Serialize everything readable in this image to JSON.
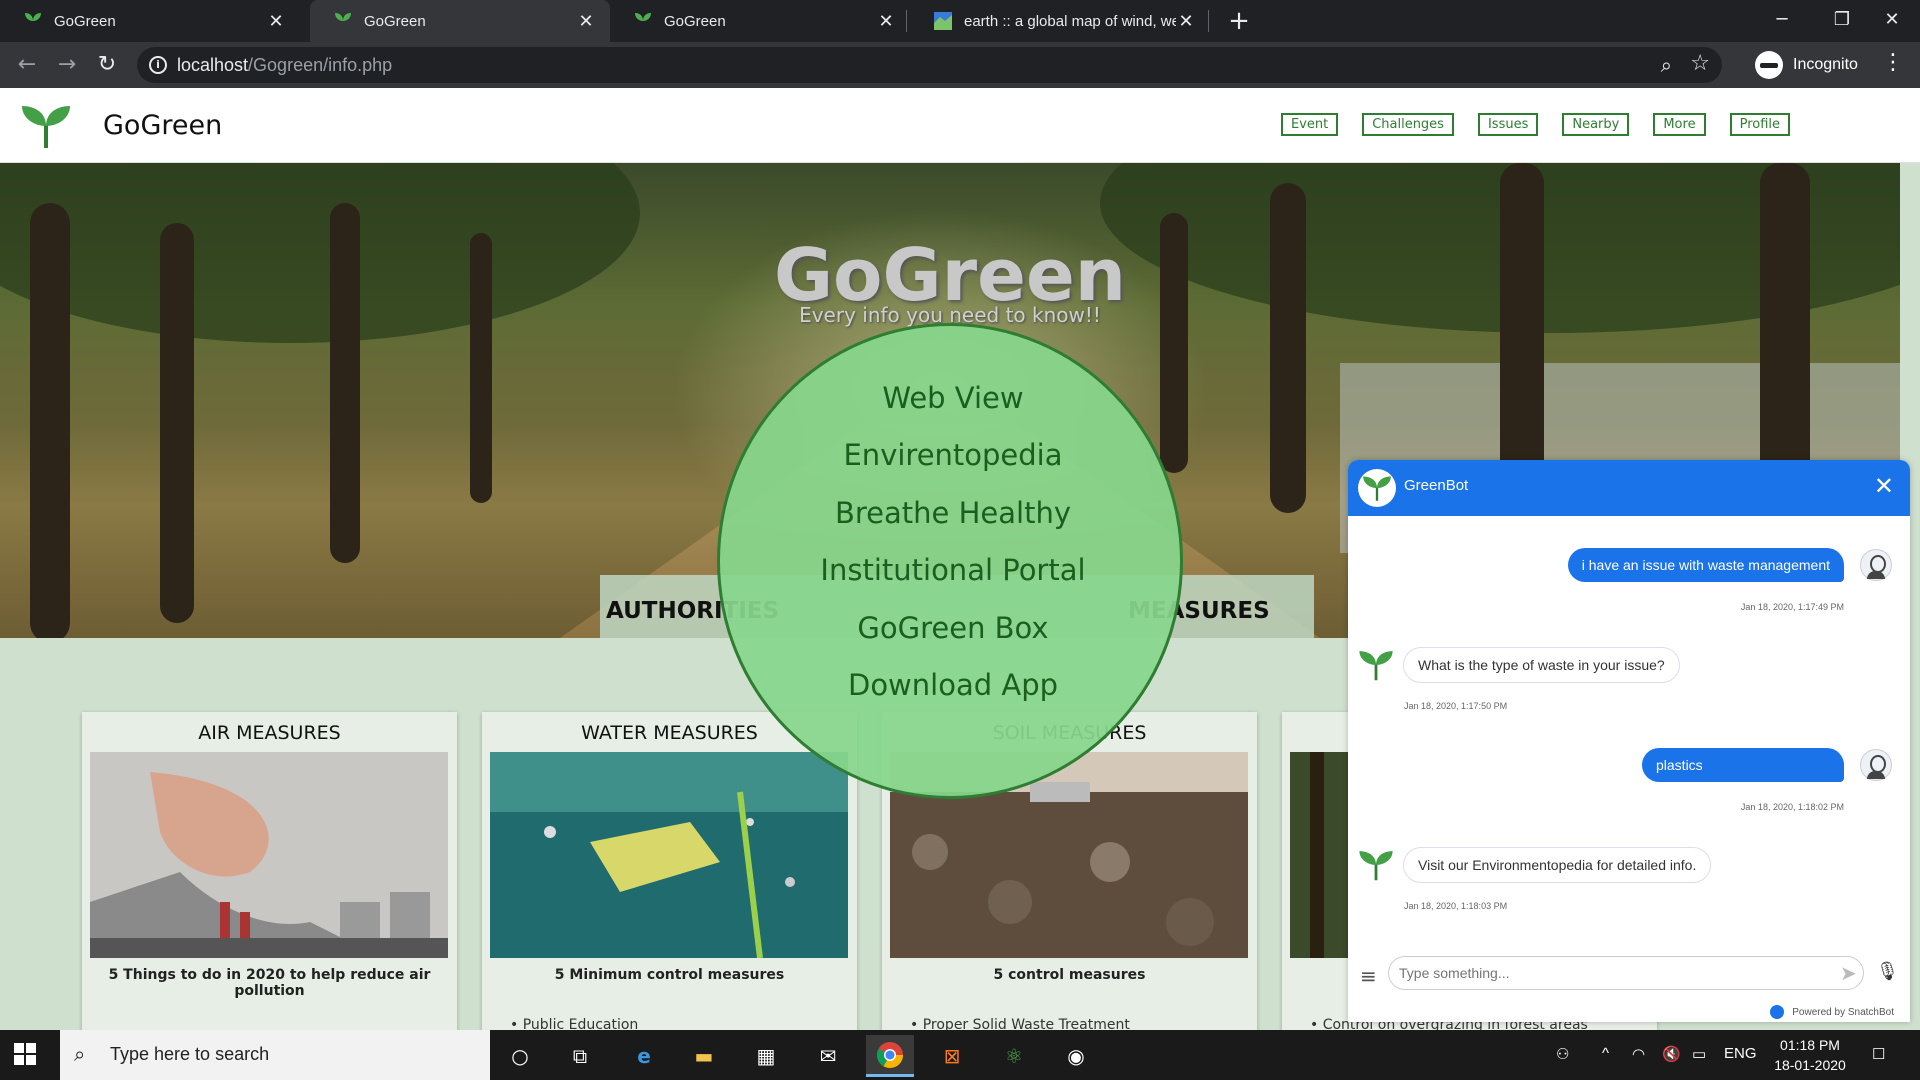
{
  "browser": {
    "tabs": [
      {
        "title": "GoGreen",
        "icon": "leaf-icon"
      },
      {
        "title": "GoGreen",
        "icon": "leaf-icon",
        "active": true
      },
      {
        "title": "GoGreen",
        "icon": "leaf-icon"
      },
      {
        "title": "earth :: a global map of wind, we",
        "icon": "earth-icon"
      }
    ],
    "url_host": "localhost",
    "url_path": "/Gogreen/info.php",
    "profile_label": "Incognito"
  },
  "site": {
    "brand": "GoGreen",
    "nav": [
      "Event",
      "Challenges",
      "Issues",
      "Nearby",
      "More",
      "Profile"
    ]
  },
  "hero": {
    "title": "GoGreen",
    "subtitle": "Every info you need to know!!"
  },
  "section_tabs": {
    "left": "AUTHORITIES",
    "right": "MEASURES"
  },
  "circle_menu": [
    "Web View",
    "Envirentopedia",
    "Breathe Healthy",
    "Institutional Portal",
    "GoGreen Box",
    "Download App"
  ],
  "cards": [
    {
      "title": "AIR MEASURES",
      "desc": "5 Things to do in 2020 to help reduce air pollution",
      "bullet": ""
    },
    {
      "title": "WATER MEASURES",
      "desc": "5 Minimum control measures",
      "bullet": "Public Education"
    },
    {
      "title": "SOIL MEASURES",
      "desc": "5 control measures",
      "bullet": "Proper Solid Waste Treatment"
    },
    {
      "title": "",
      "desc": "",
      "bullet": "Control on overgrazing in forest areas"
    }
  ],
  "chat": {
    "bot_name": "GreenBot",
    "messages": [
      {
        "from": "user",
        "text": "i have an issue with waste management",
        "time": "Jan 18, 2020, 1:17:49 PM"
      },
      {
        "from": "bot",
        "text": "What is the type of waste in your issue?",
        "time": "Jan 18, 2020, 1:17:50 PM"
      },
      {
        "from": "user",
        "text": "plastics",
        "time": "Jan 18, 2020, 1:18:02 PM"
      },
      {
        "from": "bot",
        "text": "Visit our Environmentopedia for detailed info.",
        "time": "Jan 18, 2020, 1:18:03 PM"
      }
    ],
    "input_placeholder": "Type something...",
    "powered_by": "Powered by SnatchBot"
  },
  "taskbar": {
    "search_placeholder": "Type here to search",
    "language": "ENG",
    "time": "01:18 PM",
    "date": "18-01-2020"
  },
  "colors": {
    "brand_green": "#2e7d32",
    "circle_fill": "#86d68c",
    "chat_blue": "#1a73e8"
  }
}
